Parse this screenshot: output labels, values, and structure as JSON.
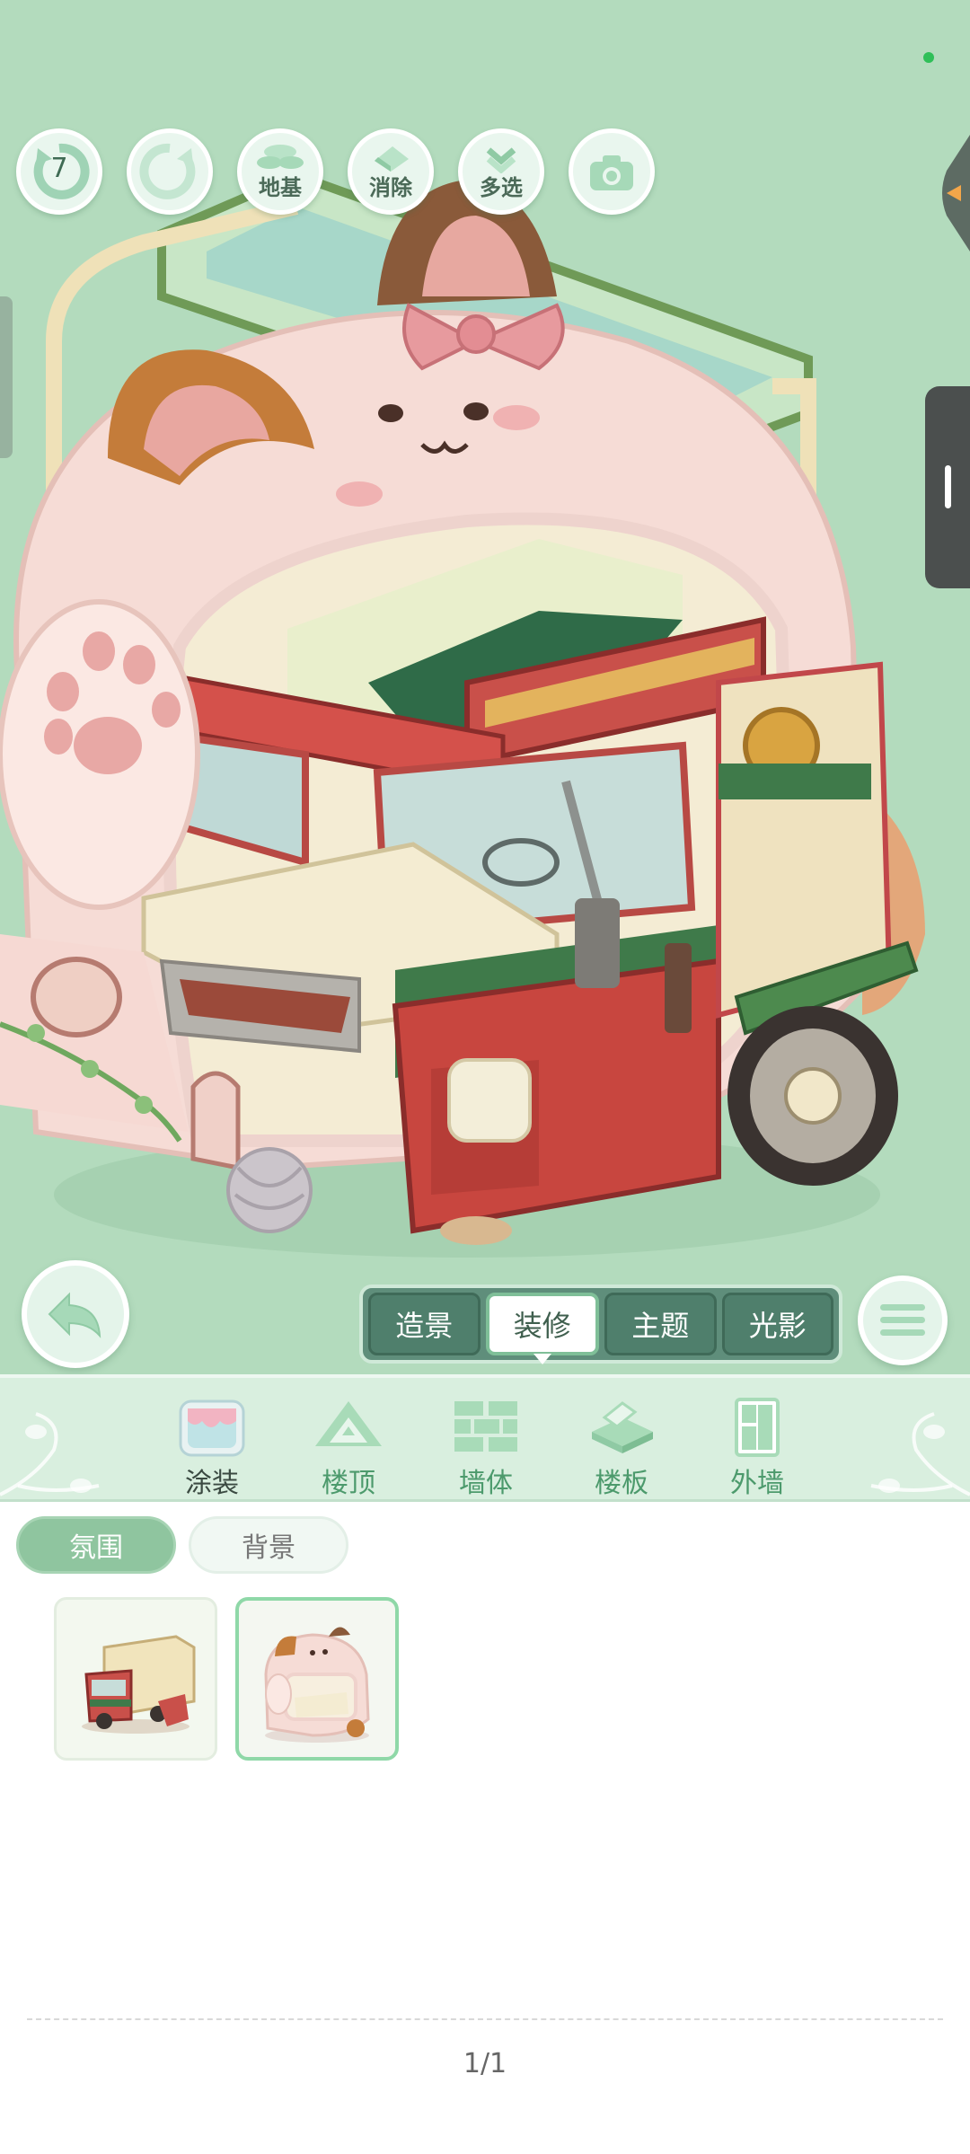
{
  "toolbar": {
    "undo_count": "7",
    "base_label": "地基",
    "erase_label": "消除",
    "multiselect_label": "多选"
  },
  "mode_tabs": [
    {
      "label": "造景",
      "active": false
    },
    {
      "label": "装修",
      "active": true
    },
    {
      "label": "主题",
      "active": false
    },
    {
      "label": "光影",
      "active": false
    }
  ],
  "categories": [
    {
      "label": "涂装",
      "icon": "paint-bucket-icon",
      "active": true
    },
    {
      "label": "楼顶",
      "icon": "roof-icon",
      "active": false
    },
    {
      "label": "墙体",
      "icon": "brick-wall-icon",
      "active": false
    },
    {
      "label": "楼板",
      "icon": "floor-slab-icon",
      "active": false
    },
    {
      "label": "外墙",
      "icon": "exterior-wall-icon",
      "active": false
    }
  ],
  "filters": {
    "atmosphere": "氛围",
    "background": "背景"
  },
  "items": [
    {
      "name": "truck-house",
      "selected": false
    },
    {
      "name": "cat-house",
      "selected": true
    }
  ],
  "pager": "1/1",
  "colors": {
    "scene_bg": "#b3dbbd",
    "accent_green": "#8fc59f",
    "tab_bg": "#5f8e7b"
  }
}
